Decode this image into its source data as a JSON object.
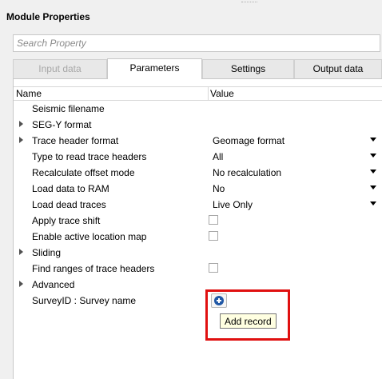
{
  "window": {
    "title": "Module Properties"
  },
  "search": {
    "placeholder": "Search Property"
  },
  "tabs": [
    {
      "label": "Input data",
      "state": "disabled"
    },
    {
      "label": "Parameters",
      "state": "active"
    },
    {
      "label": "Settings",
      "state": "normal"
    },
    {
      "label": "Output data",
      "state": "normal"
    }
  ],
  "columns": {
    "name": "Name",
    "value": "Value"
  },
  "rows": [
    {
      "name": "Seismic filename",
      "expandable": false,
      "value": ""
    },
    {
      "name": "SEG-Y format",
      "expandable": true,
      "value": ""
    },
    {
      "name": "Trace header format",
      "expandable": true,
      "value": "Geomage format",
      "control": "dropdown"
    },
    {
      "name": "Type to read trace headers",
      "expandable": false,
      "value": "All",
      "control": "dropdown"
    },
    {
      "name": "Recalculate offset mode",
      "expandable": false,
      "value": "No recalculation",
      "control": "dropdown"
    },
    {
      "name": "Load data to RAM",
      "expandable": false,
      "value": "No",
      "control": "dropdown"
    },
    {
      "name": "Load dead traces",
      "expandable": false,
      "value": "Live Only",
      "control": "dropdown"
    },
    {
      "name": "Apply trace shift",
      "expandable": false,
      "value": "",
      "control": "checkbox",
      "checked": false
    },
    {
      "name": "Enable active location map",
      "expandable": false,
      "value": "",
      "control": "checkbox",
      "checked": false
    },
    {
      "name": "Sliding",
      "expandable": true,
      "value": ""
    },
    {
      "name": "Find ranges of trace headers",
      "expandable": false,
      "value": "",
      "control": "checkbox",
      "checked": false
    },
    {
      "name": "Advanced",
      "expandable": true,
      "value": ""
    },
    {
      "name": "SurveyID : Survey name",
      "expandable": false,
      "value": "",
      "control": "add-button"
    }
  ],
  "add_button": {
    "icon": "plus-circle-icon",
    "tooltip": "Add record"
  },
  "colors": {
    "highlight": "#e01010",
    "add_icon": "#1f57a5",
    "tooltip_bg": "#ffffe1"
  }
}
